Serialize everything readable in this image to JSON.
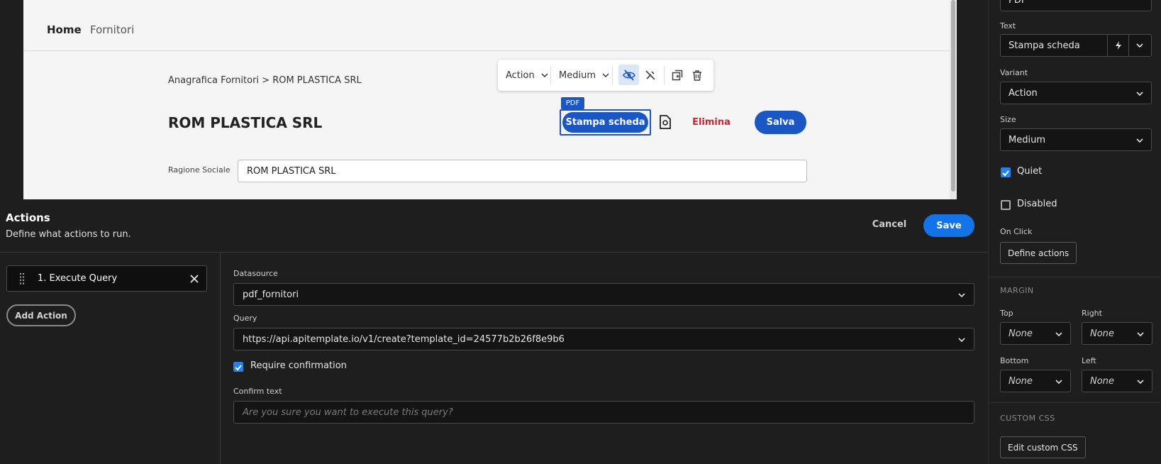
{
  "preview": {
    "nav": {
      "home": "Home",
      "fornitori": "Fornitori"
    },
    "breadcrumb": "Anagrafica Fornitori > ROM PLASTICA SRL",
    "title": "ROM PLASTICA SRL",
    "toolbar": {
      "variant": "Action",
      "size": "Medium"
    },
    "pdf_tag": "PDF",
    "buttons": {
      "stampa": "Stampa scheda",
      "elimina": "Elimina",
      "salva": "Salva"
    },
    "ragione_sociale": {
      "label": "Ragione Sociale",
      "value": "ROM PLASTICA SRL"
    }
  },
  "actions": {
    "title": "Actions",
    "subtitle": "Define what actions to run.",
    "cancel": "Cancel",
    "save": "Save",
    "items": [
      {
        "label": "1. Execute Query"
      }
    ],
    "add_action": "Add Action",
    "datasource": {
      "label": "Datasource",
      "value": "pdf_fornitori"
    },
    "query": {
      "label": "Query",
      "value": "https://api.apitemplate.io/v1/create?template_id=24577b2b26f8e9b6"
    },
    "require_confirmation": {
      "label": "Require confirmation",
      "checked": true
    },
    "confirm_text": {
      "label": "Confirm text",
      "placeholder": "Are you sure you want to execute this query?"
    }
  },
  "props": {
    "top_value": "PDF",
    "text": {
      "label": "Text",
      "value": "Stampa scheda"
    },
    "variant": {
      "label": "Variant",
      "value": "Action"
    },
    "size": {
      "label": "Size",
      "value": "Medium"
    },
    "quiet": {
      "label": "Quiet",
      "checked": true
    },
    "disabled": {
      "label": "Disabled",
      "checked": false
    },
    "on_click": {
      "label": "On Click",
      "button": "Define actions"
    },
    "margin": {
      "heading": "MARGIN",
      "top": {
        "label": "Top",
        "value": "None"
      },
      "right": {
        "label": "Right",
        "value": "None"
      },
      "bottom": {
        "label": "Bottom",
        "value": "None"
      },
      "left": {
        "label": "Left",
        "value": "None"
      }
    },
    "custom_css": {
      "heading": "CUSTOM CSS",
      "button": "Edit custom CSS"
    }
  },
  "colors": {
    "accent": "#1473e6",
    "preview_button": "#1a56c4",
    "danger": "#c9252d"
  }
}
